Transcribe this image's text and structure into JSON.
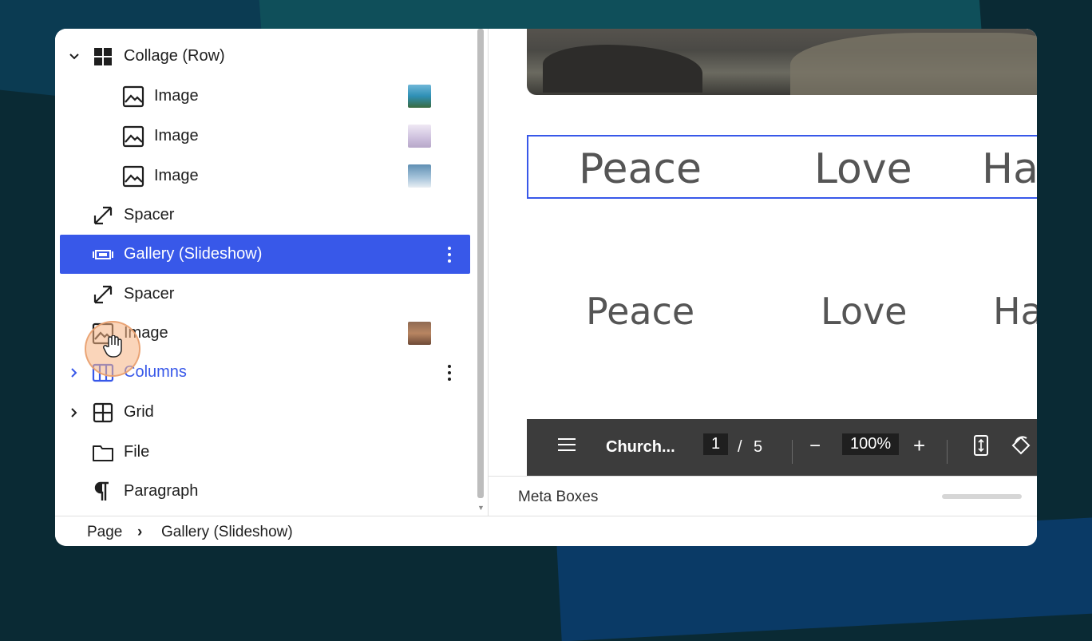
{
  "list_view": {
    "rows": [
      {
        "label": "Collage (Row)",
        "icon": "row-grid-icon",
        "expanded": true
      },
      {
        "label": "Image",
        "icon": "image-icon",
        "thumb": "#4d9fc4"
      },
      {
        "label": "Image",
        "icon": "image-icon",
        "thumb": "#d8cde6"
      },
      {
        "label": "Image",
        "icon": "image-icon",
        "thumb": "#8fb6d3"
      },
      {
        "label": "Spacer",
        "icon": "resize-arrow-icon"
      },
      {
        "label": "Gallery (Slideshow)",
        "icon": "slideshow-icon",
        "selected": true
      },
      {
        "label": "Spacer",
        "icon": "resize-arrow-icon"
      },
      {
        "label": "Image",
        "icon": "image-icon",
        "thumb": "#a07458"
      },
      {
        "label": "Columns",
        "icon": "columns-icon",
        "expandable": true
      },
      {
        "label": "Grid",
        "icon": "grid-icon",
        "expandable": true
      },
      {
        "label": "File",
        "icon": "folder-icon"
      },
      {
        "label": "Paragraph",
        "icon": "pilcrow-icon"
      }
    ]
  },
  "canvas": {
    "slide_words": [
      "Peace",
      "Love",
      "Ha"
    ],
    "caption_words": [
      "Peace",
      "Love",
      "Ha"
    ]
  },
  "pdf_toolbar": {
    "title": "Church...",
    "page_current": "1",
    "page_sep": "/",
    "page_total": "5",
    "zoom": "100%",
    "minus": "−",
    "plus": "+"
  },
  "meta": {
    "label": "Meta Boxes"
  },
  "breadcrumb": {
    "root": "Page",
    "sep": "›",
    "current": "Gallery (Slideshow)"
  },
  "colors": {
    "accent": "#3858e9"
  }
}
